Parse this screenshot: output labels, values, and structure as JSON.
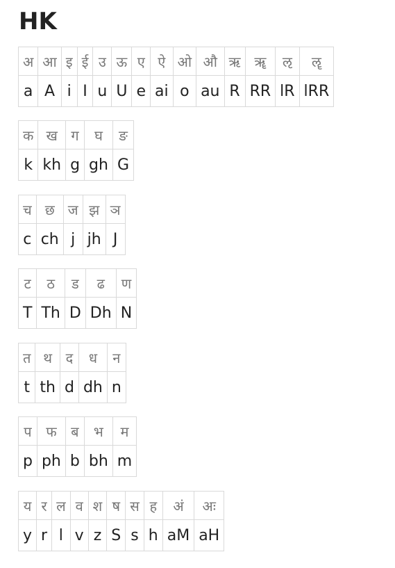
{
  "title": "HK",
  "tables": [
    {
      "id": "vowels",
      "devanagari": [
        "अ",
        "आ",
        "इ",
        "ई",
        "उ",
        "ऊ",
        "ए",
        "ऐ",
        "ओ",
        "औ",
        "ऋ",
        "ॠ",
        "ऌ",
        "ॡ"
      ],
      "roman": [
        "a",
        "A",
        "i",
        "I",
        "u",
        "U",
        "e",
        "ai",
        "o",
        "au",
        "R",
        "RR",
        "lR",
        "lRR"
      ]
    },
    {
      "id": "velar",
      "devanagari": [
        "क",
        "ख",
        "ग",
        "घ",
        "ङ"
      ],
      "roman": [
        "k",
        "kh",
        "g",
        "gh",
        "G"
      ]
    },
    {
      "id": "palatal",
      "devanagari": [
        "च",
        "छ",
        "ज",
        "झ",
        "ञ"
      ],
      "roman": [
        "c",
        "ch",
        "j",
        "jh",
        "J"
      ]
    },
    {
      "id": "retroflex",
      "devanagari": [
        "ट",
        "ठ",
        "ड",
        "ढ",
        "ण"
      ],
      "roman": [
        "T",
        "Th",
        "D",
        "Dh",
        "N"
      ]
    },
    {
      "id": "dental",
      "devanagari": [
        "त",
        "थ",
        "द",
        "ध",
        "न"
      ],
      "roman": [
        "t",
        "th",
        "d",
        "dh",
        "n"
      ]
    },
    {
      "id": "labial",
      "devanagari": [
        "प",
        "फ",
        "ब",
        "भ",
        "म"
      ],
      "roman": [
        "p",
        "ph",
        "b",
        "bh",
        "m"
      ]
    },
    {
      "id": "misc",
      "devanagari": [
        "य",
        "र",
        "ल",
        "व",
        "श",
        "ष",
        "स",
        "ह",
        "अं",
        "अः"
      ],
      "roman": [
        "y",
        "r",
        "l",
        "v",
        "z",
        "S",
        "s",
        "h",
        "aM",
        "aH"
      ]
    }
  ]
}
